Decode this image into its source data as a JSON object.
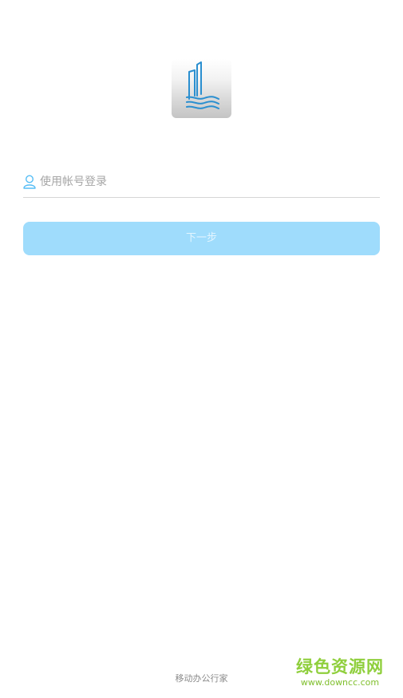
{
  "app": {
    "logo_icon": "building-waves-logo-icon"
  },
  "login": {
    "account_placeholder": "使用帐号登录",
    "account_value": "",
    "user_icon": "user-icon",
    "next_label": "下一步"
  },
  "footer": {
    "tagline": "移动办公行家"
  },
  "watermark": {
    "title": "绿色资源网",
    "url": "www.downcc.com"
  },
  "colors": {
    "accent": "#55bdf5",
    "button_bg": "#9fdcfc",
    "logo_blue": "#2a8fd0"
  }
}
